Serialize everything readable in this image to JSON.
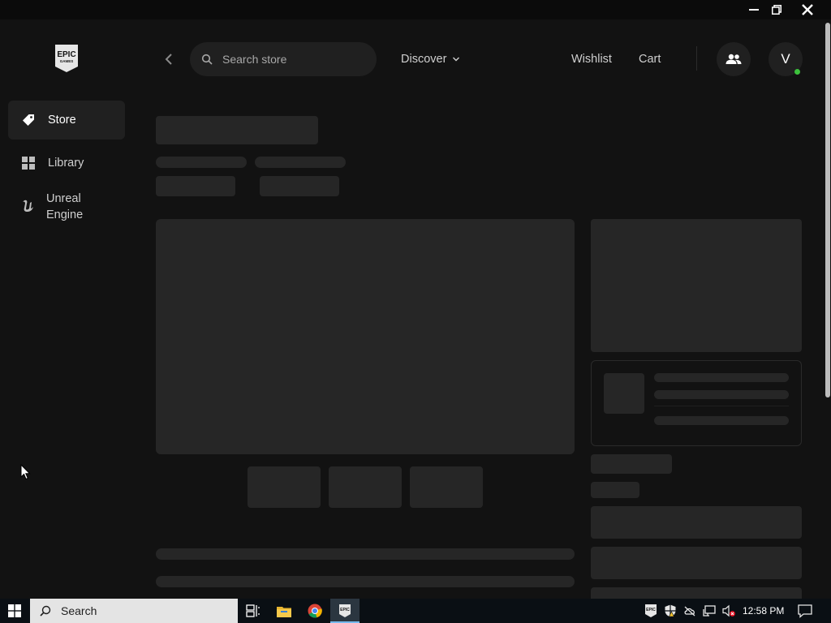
{
  "app": {
    "logo_text_top": "EPIC",
    "logo_text_bottom": "GAMES"
  },
  "sidebar": {
    "items": [
      {
        "label": "Store",
        "icon": "tag-icon",
        "active": true
      },
      {
        "label": "Library",
        "icon": "grid-icon",
        "active": false
      },
      {
        "label": "Unreal\nEngine",
        "icon": "unreal-engine-icon",
        "active": false
      }
    ]
  },
  "header": {
    "search_placeholder": "Search store",
    "discover_label": "Discover",
    "wishlist_label": "Wishlist",
    "cart_label": "Cart",
    "avatar_initial": "V"
  },
  "taskbar": {
    "search_label": "Search",
    "tray_epic_text": "EPIC",
    "clock": "12:58 PM"
  },
  "colors": {
    "background": "#121212",
    "surface": "#202020",
    "skeleton": "#262626",
    "online": "#3cc13c",
    "taskbar": "#0a0f14"
  }
}
